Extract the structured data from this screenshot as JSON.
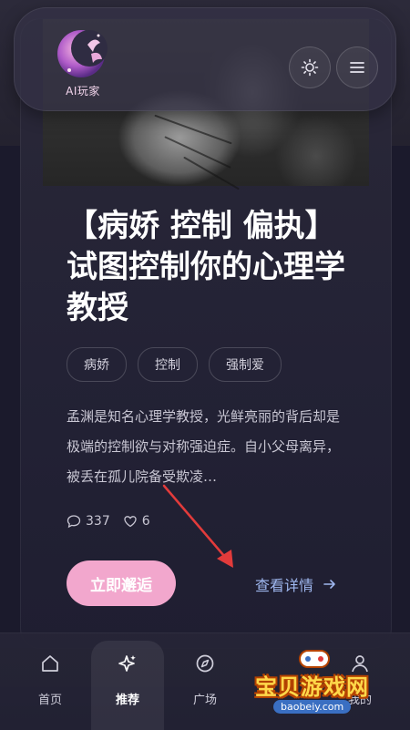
{
  "header": {
    "logo_text": "AI玩家",
    "theme_icon": "sun-icon",
    "menu_icon": "hamburger-menu-icon"
  },
  "card": {
    "title": "【病娇 控制 偏执】试图控制你的心理学教授",
    "tags": [
      "病娇",
      "控制",
      "强制爱"
    ],
    "description": "孟渊是知名心理学教授，光鲜亮丽的背后却是极端的控制欲与对称强迫症。自小父母离异，被丢在孤儿院备受欺凌…",
    "comments": "337",
    "likes": "6",
    "cta_label": "立即邂逅",
    "details_label": "查看详情"
  },
  "bottom_nav": [
    {
      "label": "首页",
      "icon": "home-icon"
    },
    {
      "label": "推荐",
      "icon": "sparkle-icon",
      "active": true
    },
    {
      "label": "广场",
      "icon": "compass-icon"
    },
    {
      "label": "我的",
      "icon": "user-icon"
    }
  ],
  "watermark": {
    "text": "宝贝游戏网",
    "url": "baobeiy.com"
  },
  "colors": {
    "background": "#1b1a2c",
    "accent_pink": "#f2a7cd",
    "link_blue": "#9fb8f0",
    "annotation_red": "#e23b3b"
  }
}
